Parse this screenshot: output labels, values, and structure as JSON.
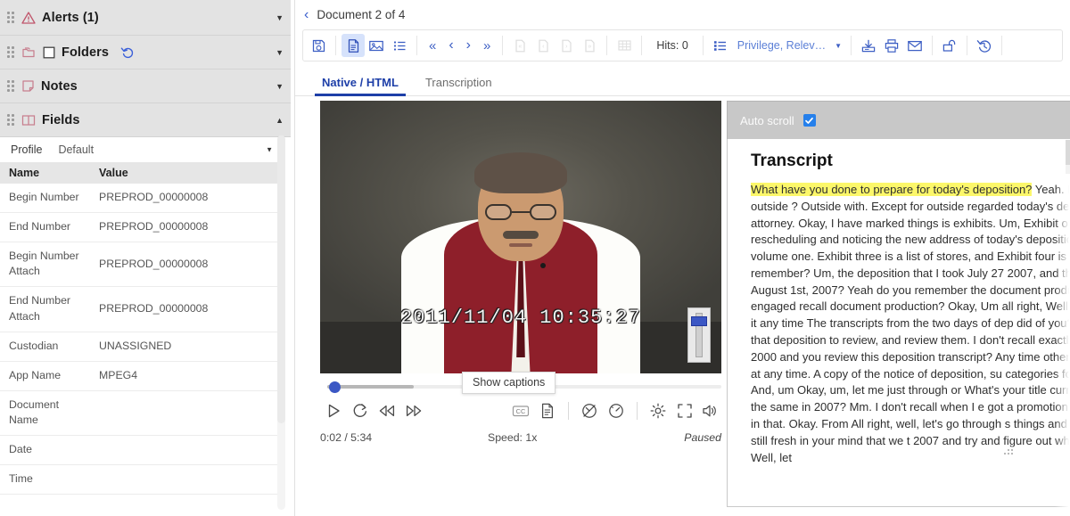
{
  "sidebar": {
    "sections": [
      {
        "id": "alerts",
        "label": "Alerts (1)",
        "icon": "warning-triangle-icon",
        "caret": "▼"
      },
      {
        "id": "folders",
        "label": "Folders",
        "icon": "folder-icon",
        "caret": "▼"
      },
      {
        "id": "notes",
        "label": "Notes",
        "icon": "note-icon",
        "caret": "▼"
      },
      {
        "id": "fields",
        "label": "Fields",
        "icon": "columns-icon",
        "caret": "▲"
      }
    ],
    "profile": {
      "label": "Profile",
      "value": "Default",
      "caret": "▼"
    },
    "table": {
      "headers": [
        "Name",
        "Value"
      ],
      "rows": [
        {
          "name": "Begin Number",
          "value": "PREPROD_00000008"
        },
        {
          "name": "End Number",
          "value": "PREPROD_00000008"
        },
        {
          "name": "Begin Number Attach",
          "value": "PREPROD_00000008"
        },
        {
          "name": "End Number Attach",
          "value": "PREPROD_00000008"
        },
        {
          "name": "Custodian",
          "value": "UNASSIGNED"
        },
        {
          "name": "App Name",
          "value": "MPEG4"
        },
        {
          "name": "Document Name",
          "value": ""
        },
        {
          "name": "Date",
          "value": ""
        },
        {
          "name": "Time",
          "value": ""
        }
      ]
    }
  },
  "main": {
    "doc_nav": {
      "back": "‹",
      "title": "Document 2 of 4"
    },
    "toolbar": {
      "hits_label": "Hits: 0",
      "privilege_label": "Privilege, Relev…",
      "privilege_caret": "▼",
      "buttons": [
        {
          "name": "save-icon",
          "state": "enabled"
        },
        {
          "name": "document-view-icon",
          "state": "active"
        },
        {
          "name": "image-view-icon",
          "state": "enabled"
        },
        {
          "name": "list-view-icon",
          "state": "enabled"
        },
        {
          "name": "first-document-icon",
          "state": "enabled"
        },
        {
          "name": "previous-document-icon",
          "state": "enabled"
        },
        {
          "name": "next-document-icon",
          "state": "enabled"
        },
        {
          "name": "last-document-icon",
          "state": "enabled"
        },
        {
          "name": "first-page-icon",
          "state": "disabled"
        },
        {
          "name": "previous-page-icon",
          "state": "disabled"
        },
        {
          "name": "next-page-icon",
          "state": "disabled"
        },
        {
          "name": "last-page-icon",
          "state": "disabled"
        },
        {
          "name": "grid-view-icon",
          "state": "disabled"
        },
        {
          "name": "coding-list-icon",
          "state": "enabled"
        },
        {
          "name": "download-icon",
          "state": "enabled"
        },
        {
          "name": "print-icon",
          "state": "enabled"
        },
        {
          "name": "email-icon",
          "state": "enabled"
        },
        {
          "name": "unlock-icon",
          "state": "enabled"
        },
        {
          "name": "history-icon",
          "state": "enabled"
        }
      ]
    },
    "tabs": [
      {
        "label": "Native / HTML",
        "active": true
      },
      {
        "label": "Transcription",
        "active": false
      }
    ]
  },
  "video": {
    "overlay_timestamp": "2011/11/04 10:35:27",
    "tooltip": "Show captions",
    "time_display": "0:02 / 5:34",
    "speed_display": "Speed: 1x",
    "state_display": "Paused",
    "progress_percent": 0.6,
    "controls": [
      "play-icon",
      "replay-icon",
      "rewind-icon",
      "fast-forward-icon",
      "closed-captions-icon",
      "transcript-icon",
      "speed-down-icon",
      "speed-up-icon",
      "settings-gear-icon",
      "fullscreen-icon",
      "volume-icon"
    ]
  },
  "transcript": {
    "auto_scroll_label": "Auto scroll",
    "auto_scroll_checked": true,
    "title": "Transcript",
    "highlighted": "What have you done to prepare for today's deposition?",
    "body": " Yeah. have you spoken to outside ? Outside with. Except for outside regarded today's deposition. Just attorney. Okay, I have marked things is exhibits. Um, Exhibit one is a letter rescheduling and noticing the new address of today's deposition. Exhibit two is volume one. Exhibit three is a list of stores, and Exhibit four is list of stores. Do you remember? Um, the deposition that I took July 27 2007, and then also again on August 1st, 2007? Yeah do you remember the document production that I was engaged recall document production? Okay, Um all right, Well, have you you read it any time The transcripts from the two days of dep did of you? I believe I was sent that deposition to review, and review them. I don't recall exactly . Was that back in 2000 and you review this deposition transcript? Any time other than the given today at any time. A copy of the notice of deposition, su categories for production. No. And, um Okay, um, let me just through or What's your title currently? Okay. Is that the same in 2007? Mm. I don't recall when I e got a promotion couple y I'm aimed in that. Okay. From All right, well, let's go through s things and make sure they're still fresh in your mind that we t 2007 and try and figure out why you didn't do any. Well, let"
  },
  "colors": {
    "accent_blue": "#3d5fc4",
    "tab_active": "#1e3fa8",
    "highlight_yellow": "#fcf76a",
    "icon_pink": "#d07f8e",
    "panel_gray": "#e3e3e3",
    "transcript_header_gray": "#c8c8c8"
  }
}
